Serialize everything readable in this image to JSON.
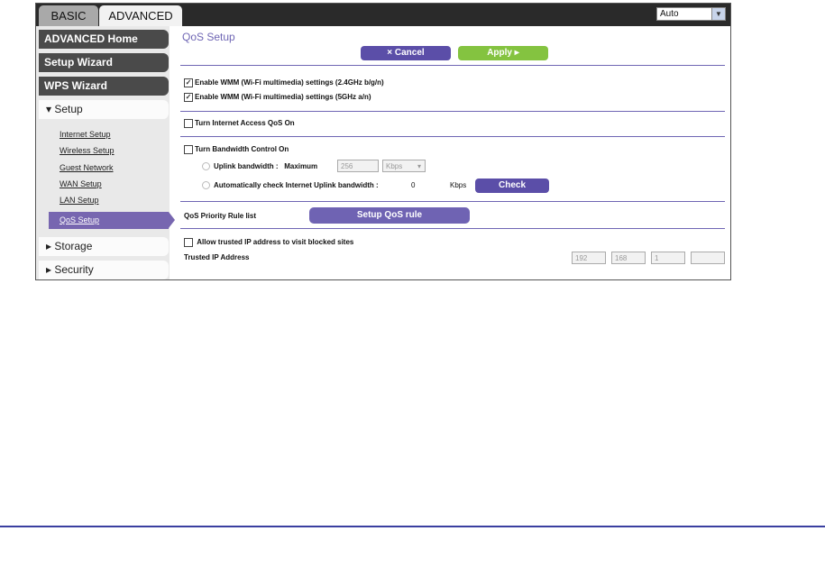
{
  "tabs": {
    "basic": "BASIC",
    "advanced": "ADVANCED"
  },
  "language": {
    "selected": "Auto"
  },
  "sidebar": {
    "buttons": [
      "ADVANCED Home",
      "Setup Wizard",
      "WPS Wizard"
    ],
    "setup_section": "▾ Setup",
    "links": [
      "Internet Setup",
      "Wireless Setup",
      "Guest Network",
      "WAN Setup",
      "LAN Setup"
    ],
    "active": "QoS Setup",
    "sections": [
      "▸ Storage",
      "▸ Security"
    ]
  },
  "main": {
    "title": "QoS Setup",
    "cancel": "×   Cancel",
    "apply": "Apply   ▸",
    "wmm_24": "Enable WMM (Wi-Fi multimedia) settings (2.4GHz b/g/n)",
    "wmm_5": "Enable WMM (Wi-Fi multimedia) settings (5GHz a/n)",
    "internet_qos": "Turn Internet Access QoS On",
    "bandwidth_control": "Turn Bandwidth Control On",
    "uplink_label": "Uplink bandwidth :",
    "maximum_label": "Maximum",
    "uplink_value": "256",
    "uplink_unit": "Kbps",
    "auto_check": "Automatically check Internet Uplink bandwidth :",
    "auto_value": "0",
    "auto_unit": "Kbps",
    "check": "Check",
    "priority_label": "QoS Priority Rule list",
    "setup_rule": "Setup QoS rule",
    "trusted_checkbox": "Allow trusted IP address to visit blocked sites",
    "trusted_label": "Trusted IP Address",
    "ip": [
      "192",
      "168",
      "1",
      ""
    ]
  }
}
